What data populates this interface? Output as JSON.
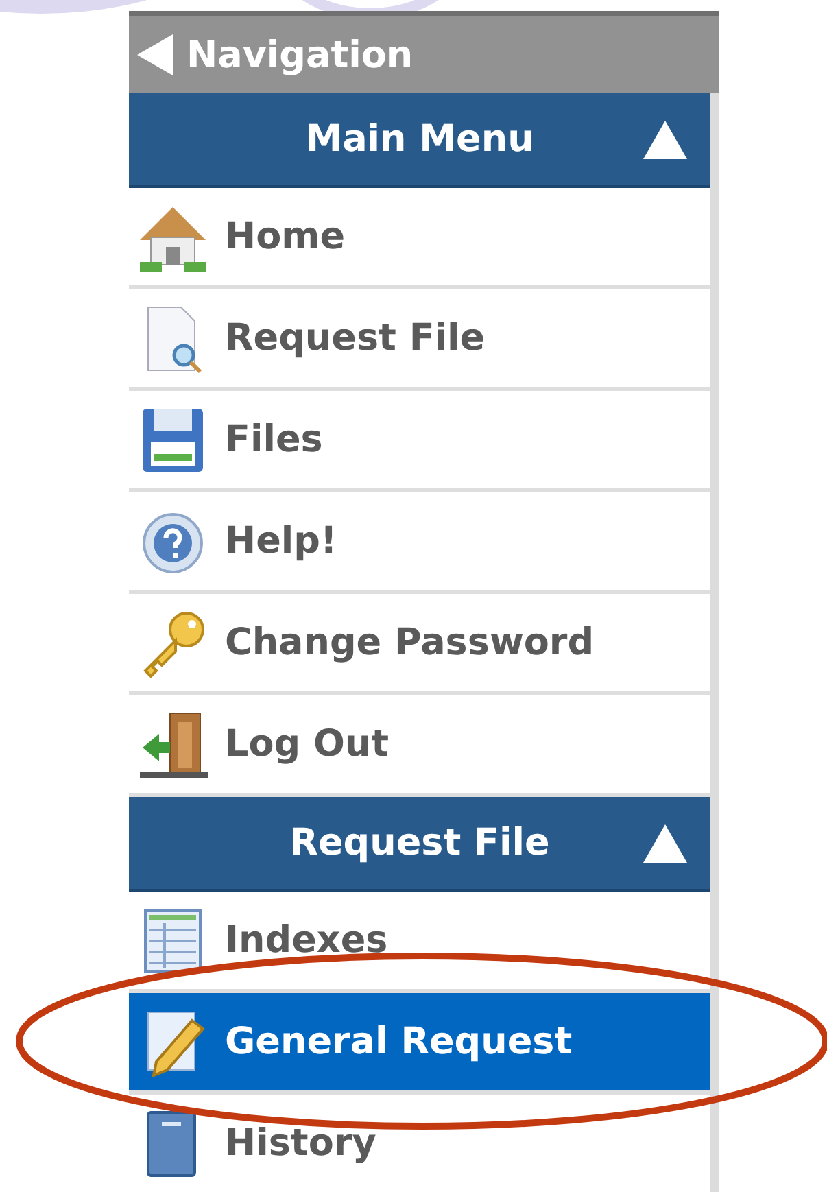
{
  "navigation": {
    "title": "Navigation"
  },
  "sections": [
    {
      "title": "Main Menu",
      "expanded": true,
      "items": [
        {
          "label": "Home",
          "kind": "home",
          "selected": false
        },
        {
          "label": "Request File",
          "kind": "search-doc",
          "selected": false
        },
        {
          "label": "Files",
          "kind": "disk",
          "selected": false
        },
        {
          "label": "Help!",
          "kind": "help",
          "selected": false
        },
        {
          "label": "Change Password",
          "kind": "key",
          "selected": false
        },
        {
          "label": "Log Out",
          "kind": "door",
          "selected": false
        }
      ]
    },
    {
      "title": "Request File",
      "expanded": true,
      "items": [
        {
          "label": "Indexes",
          "kind": "table",
          "selected": false
        },
        {
          "label": "General Request",
          "kind": "edit",
          "selected": true
        },
        {
          "label": "History",
          "kind": "book",
          "selected": false
        }
      ]
    }
  ],
  "annotation": {
    "kind": "ellipse"
  }
}
